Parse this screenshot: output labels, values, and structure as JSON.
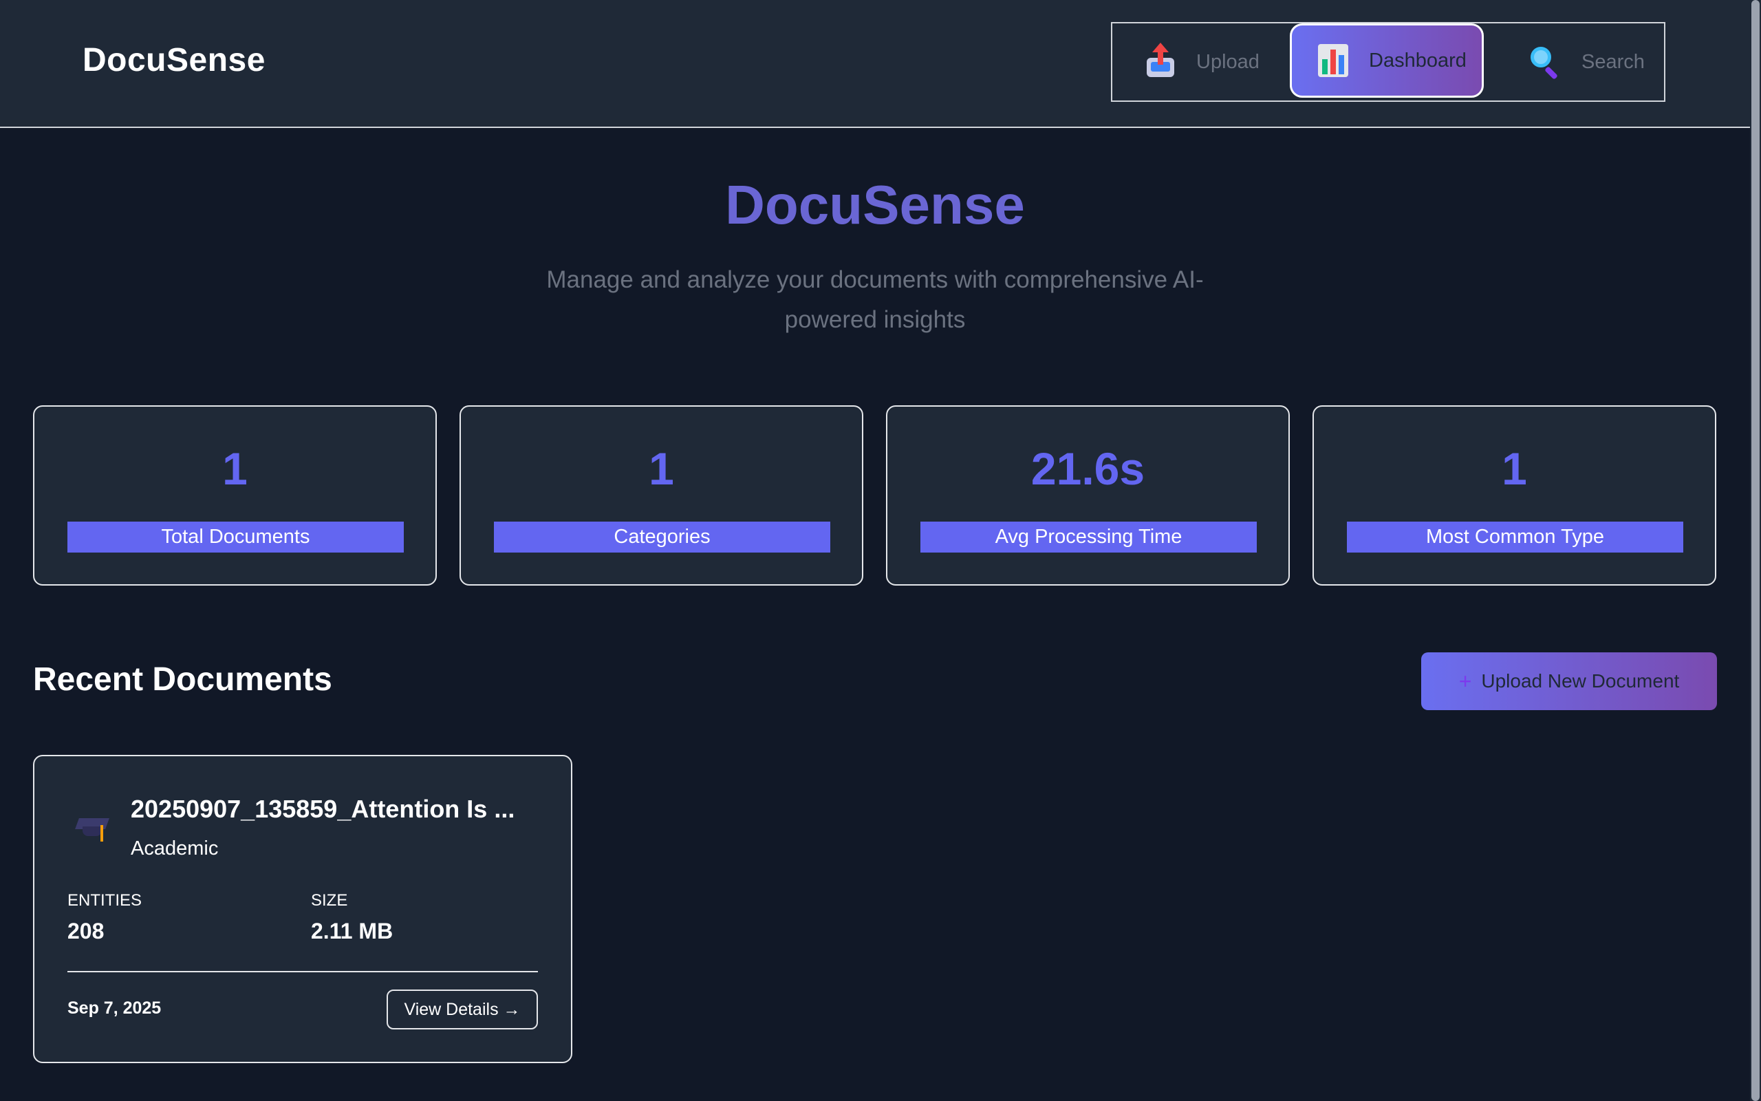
{
  "header": {
    "brand": "DocuSense",
    "nav": {
      "upload_label": "Upload",
      "dashboard_label": "Dashboard",
      "search_label": "Search",
      "active": "Dashboard"
    }
  },
  "hero": {
    "title": "DocuSense",
    "subtitle": "Manage and analyze your documents with comprehensive AI-powered insights"
  },
  "stats": [
    {
      "value": "1",
      "label": "Total Documents"
    },
    {
      "value": "1",
      "label": "Categories"
    },
    {
      "value": "21.6s",
      "label": "Avg Processing Time"
    },
    {
      "value": "1",
      "label": "Most Common Type"
    }
  ],
  "recent": {
    "title": "Recent Documents",
    "upload_button": "Upload New Document",
    "documents": [
      {
        "icon": "graduation-cap-icon",
        "title": "20250907_135859_Attention Is ...",
        "category": "Academic",
        "entities_label": "ENTITIES",
        "entities_value": "208",
        "size_label": "SIZE",
        "size_value": "2.11 MB",
        "date": "Sep 7, 2025",
        "action_label": "View Details →"
      }
    ]
  },
  "colors": {
    "background": "#111827",
    "surface": "#1f2937",
    "accent": "#6366f1",
    "gradient_start": "#6a6ff0",
    "gradient_end": "#7a4bb0"
  }
}
